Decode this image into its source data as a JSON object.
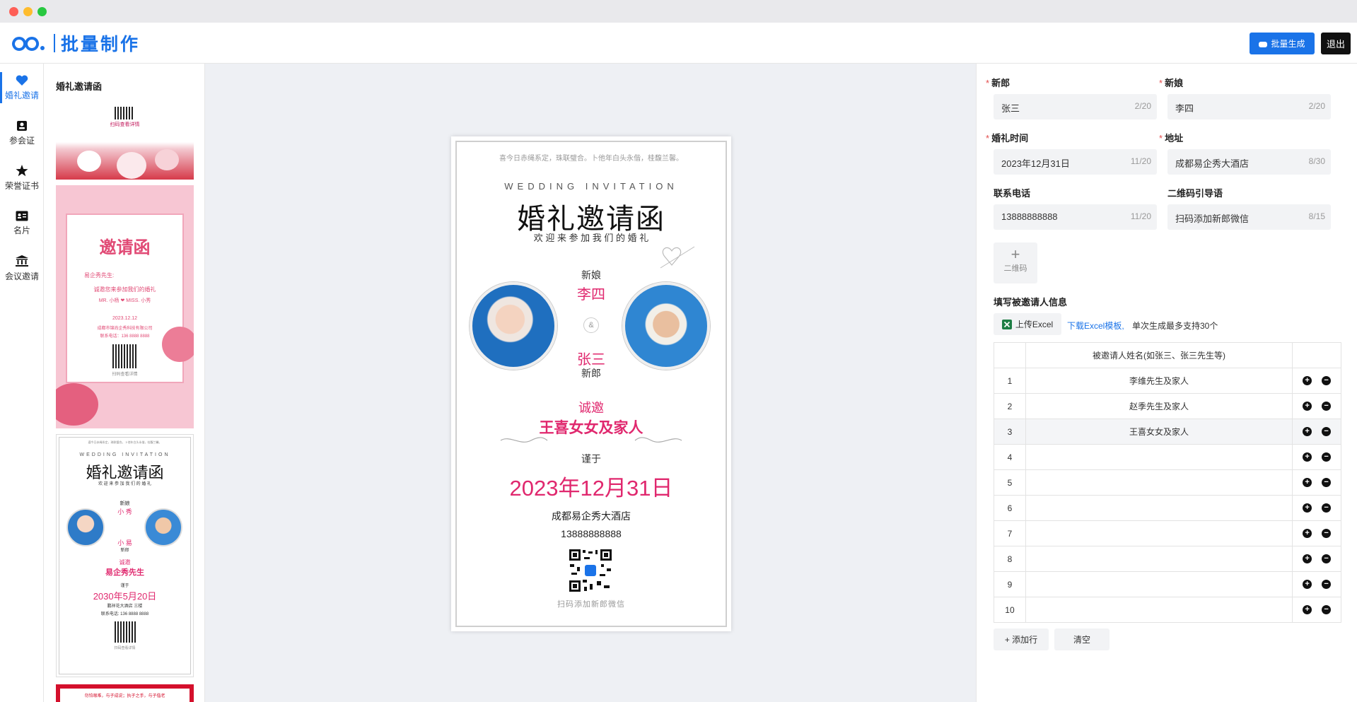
{
  "app": {
    "title": "批量制作"
  },
  "header": {
    "batch_label": "批量生成",
    "exit_label": "退出"
  },
  "nav": [
    {
      "label": "婚礼邀请",
      "icon": "heart-icon",
      "active": true
    },
    {
      "label": "参会证",
      "icon": "badge-icon",
      "active": false
    },
    {
      "label": "荣誉证书",
      "icon": "star-icon",
      "active": false
    },
    {
      "label": "名片",
      "icon": "id-card-icon",
      "active": false
    },
    {
      "label": "会议邀请",
      "icon": "bank-icon",
      "active": false
    }
  ],
  "templates": {
    "title": "婚礼邀请函",
    "t1": {
      "caption": "扫码查看详情"
    },
    "t2": {
      "heading": "邀请函",
      "greeting": "易企秀先生:",
      "line1": "诚邀您来参加我们的婚礼",
      "couple": "MR. 小杨 ❤ MISS. 小秀",
      "date": "2023.12.12",
      "addr": "成都市锦尚企秀科技有限公司",
      "phone": "联系电话：136 8888 8888",
      "caption": "扫码查看详情"
    },
    "t3": {
      "top": "遵今日赤绳系定，珠联璧合。卜他年白头永偕，桂馥兰馨。",
      "en": "WEDDING INVITATION",
      "title": "婚礼邀请函",
      "sub": "欢 迎 来 参 加 我 们 的 婚 礼",
      "bride_label": "新娘",
      "bride": "小 秀",
      "groom": "小 易",
      "groom_label": "新郎",
      "invite": "诚邀",
      "guest": "易企秀先生",
      "jin": "谨于",
      "date": "2030年5月20日",
      "venue": "鹏祥花大酒店 三楼",
      "phone": "联系电话: 136 8888 8888",
      "caption": "扫码查看详情"
    },
    "t4": {
      "text": "勿怕艰难，与子成说；执子之手，与子偕老"
    }
  },
  "card": {
    "top_text": "喜今日赤绳系定，珠联璧合。卜他年白头永偕，桂馥兰馨。",
    "en_title": "WEDDING INVITATION",
    "title": "婚礼邀请函",
    "subtitle": "欢 迎 来 参 加 我 们 的 婚 礼",
    "bride_label": "新娘",
    "bride_name": "李四",
    "amp": "&",
    "groom_name": "张三",
    "groom_label": "新郎",
    "invite_label": "诚邀",
    "guest": "王喜女女及家人",
    "jin": "谨于",
    "date": "2023年12月31日",
    "venue": "成都易企秀大酒店",
    "phone": "13888888888",
    "qr_caption": "扫码添加新郎微信"
  },
  "form": {
    "groom": {
      "label": "新郎",
      "value": "张三",
      "count": "2/20"
    },
    "bride": {
      "label": "新娘",
      "value": "李四",
      "count": "2/20"
    },
    "time": {
      "label": "婚礼时间",
      "value": "2023年12月31日",
      "count": "11/20"
    },
    "address": {
      "label": "地址",
      "value": "成都易企秀大酒店",
      "count": "8/30"
    },
    "phone": {
      "label": "联系电话",
      "value": "13888888888",
      "count": "11/20"
    },
    "qr_guide": {
      "label": "二维码引导语",
      "value": "扫码添加新郎微信",
      "count": "8/15"
    },
    "qr_upload_label": "二维码",
    "section_title": "填写被邀请人信息",
    "upload_label": "上传Excel",
    "download_link": "下载Excel模板,",
    "hint": "单次生成最多支持30个",
    "table_header": "被邀请人姓名(如张三、张三先生等)",
    "rows": [
      {
        "idx": "1",
        "name": "李维先生及家人"
      },
      {
        "idx": "2",
        "name": "赵季先生及家人"
      },
      {
        "idx": "3",
        "name": "王喜女女及家人"
      },
      {
        "idx": "4",
        "name": ""
      },
      {
        "idx": "5",
        "name": ""
      },
      {
        "idx": "6",
        "name": ""
      },
      {
        "idx": "7",
        "name": ""
      },
      {
        "idx": "8",
        "name": ""
      },
      {
        "idx": "9",
        "name": ""
      },
      {
        "idx": "10",
        "name": ""
      }
    ],
    "add_row_label": "+ 添加行",
    "clear_label": "清空"
  },
  "colors": {
    "accent": "#1a73e8",
    "pink": "#e0286e",
    "required": "#e34d4d"
  }
}
